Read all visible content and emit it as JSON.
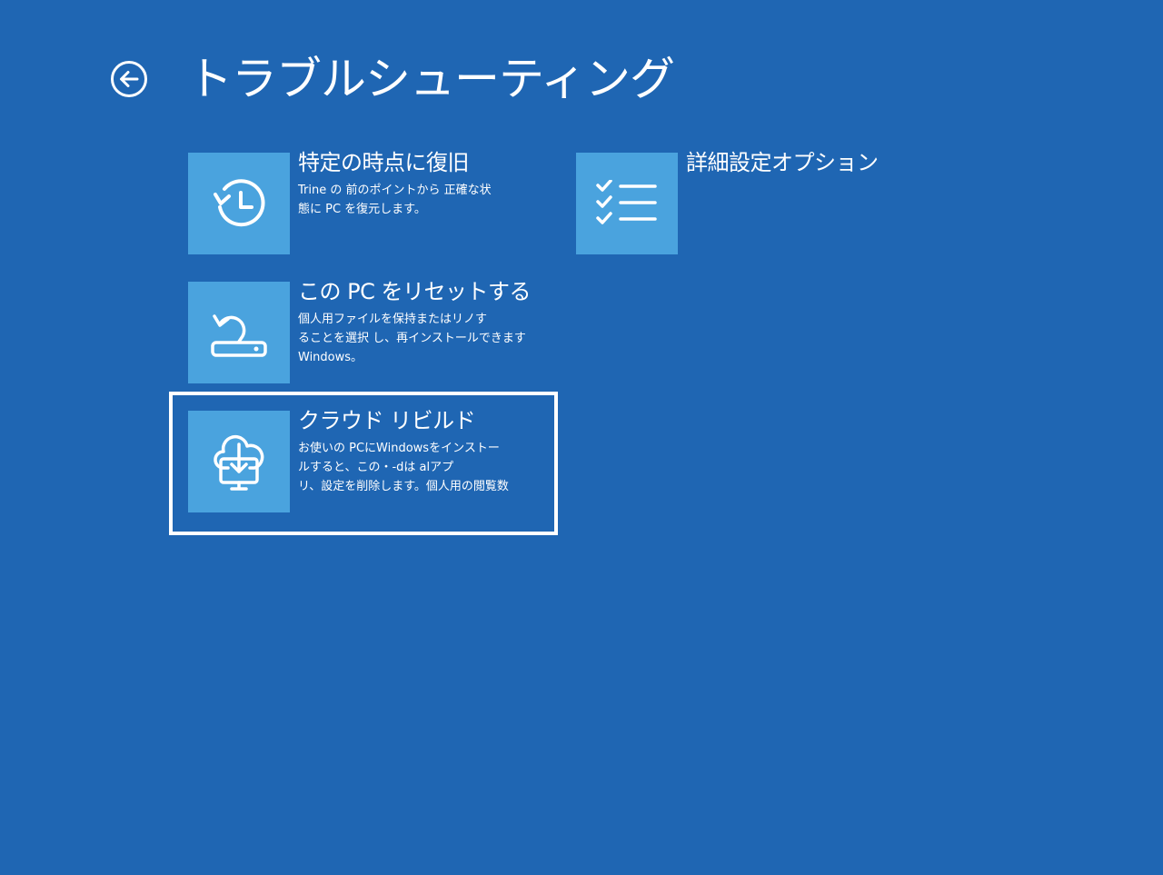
{
  "header": {
    "back_icon": "back-arrow-circle-icon",
    "title": "トラブルシューティング"
  },
  "options": [
    {
      "icon": "history-restore-icon",
      "title": "特定の時点に復旧",
      "description_lines": [
        "Trine の 前のポイントから 正確な状",
        "態に PC を復元します。"
      ]
    },
    {
      "icon": "checklist-icon",
      "title": "詳細設定オプション",
      "description_lines": []
    },
    {
      "icon": "reset-pc-icon",
      "title": "この PC をリセットする",
      "description_lines": [
        "個人用ファイルを保持またはリノす",
        "ることを選択 し、再インストールできます",
        "Windows。"
      ]
    },
    {
      "icon": "cloud-download-icon",
      "title": "クラウド リビルド",
      "description_lines": [
        "お使いの PCにWindowsをインストー",
        "ルすると、この・-dは alアプ",
        "リ、設定を削除します。個人用の閲覧数"
      ],
      "focused": true
    }
  ],
  "colors": {
    "background": "#1f66b3",
    "tile": "#4aa3de",
    "text": "#ffffff"
  }
}
